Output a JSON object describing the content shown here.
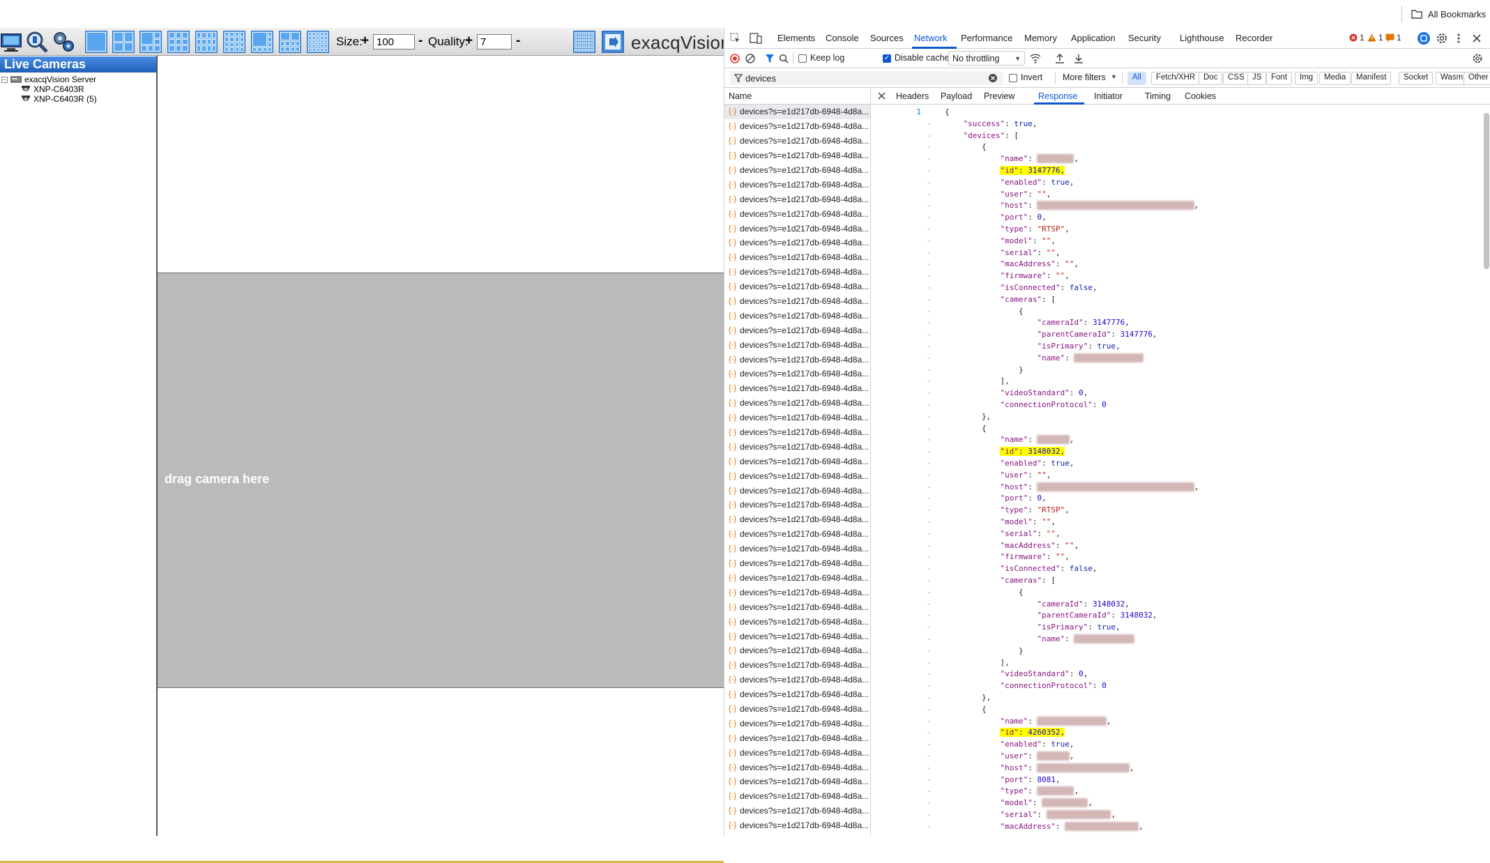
{
  "browser": {
    "bookmarks_label": "All Bookmarks"
  },
  "app": {
    "size_label": "Size:",
    "size_value": "100",
    "quality_label": "Quality:",
    "quality_value": "7",
    "plus": "+",
    "minus": "-",
    "brand": "exacqVision",
    "panel_title": "Live Cameras",
    "tree": {
      "server": "exacqVision Server",
      "cameras": [
        "XNP-C6403R",
        "XNP-C6403R (5)"
      ]
    },
    "drop_text": "drag camera here"
  },
  "devtools": {
    "tabs": [
      "Elements",
      "Console",
      "Sources",
      "Network",
      "Performance",
      "Memory",
      "Application",
      "Security",
      "Lighthouse",
      "Recorder"
    ],
    "active_tab": "Network",
    "badges": {
      "errors": "1",
      "warnings": "1",
      "issues": "1"
    },
    "toolbar": {
      "keep_log": "Keep log",
      "disable_cache": "Disable cache",
      "throttling": "No throttling"
    },
    "filter": {
      "value": "devices",
      "invert": "Invert",
      "more_filters": "More filters",
      "types": [
        "All",
        "Fetch/XHR",
        "Doc",
        "CSS",
        "JS",
        "Font",
        "Img",
        "Media",
        "Manifest",
        "Socket",
        "Wasm",
        "Other"
      ]
    },
    "name_header": "Name",
    "request_name": "devices?s=e1d217db-6948-4d8a...",
    "request_count": 50,
    "detail_tabs": [
      "Headers",
      "Payload",
      "Preview",
      "Response",
      "Initiator",
      "Timing",
      "Cookies"
    ],
    "active_detail_tab": "Response",
    "response_lines": [
      {
        "ln": "1",
        "t": "{"
      },
      {
        "t": "    \"success\": true,"
      },
      {
        "t": "    \"devices\": ["
      },
      {
        "t": "        {"
      },
      {
        "t": "            \"name\": \"██████\","
      },
      {
        "t": "            \"id\": 3147776,",
        "hl": true
      },
      {
        "t": "            \"enabled\": true,"
      },
      {
        "t": "            \"user\": \"\","
      },
      {
        "t": "            \"host\": \"████████████████████████████████\","
      },
      {
        "t": "            \"port\": 0,"
      },
      {
        "t": "            \"type\": \"RTSP\","
      },
      {
        "t": "            \"model\": \"\","
      },
      {
        "t": "            \"serial\": \"\","
      },
      {
        "t": "            \"macAddress\": \"\","
      },
      {
        "t": "            \"firmware\": \"\","
      },
      {
        "t": "            \"isConnected\": false,"
      },
      {
        "t": "            \"cameras\": ["
      },
      {
        "t": "                {"
      },
      {
        "t": "                    \"cameraId\": 3147776,"
      },
      {
        "t": "                    \"parentCameraId\": 3147776,"
      },
      {
        "t": "                    \"isPrimary\": true,"
      },
      {
        "t": "                    \"name\": \"█████████████\""
      },
      {
        "t": "                }"
      },
      {
        "t": "            ],"
      },
      {
        "t": "            \"videoStandard\": 0,"
      },
      {
        "t": "            \"connectionProtocol\": 0"
      },
      {
        "t": "        },"
      },
      {
        "t": "        {"
      },
      {
        "t": "            \"name\": \"█████\","
      },
      {
        "t": "            \"id\": 3148032,",
        "hl": true
      },
      {
        "t": "            \"enabled\": true,"
      },
      {
        "t": "            \"user\": \"\","
      },
      {
        "t": "            \"host\": \"████████████████████████████████\","
      },
      {
        "t": "            \"port\": 0,"
      },
      {
        "t": "            \"type\": \"RTSP\","
      },
      {
        "t": "            \"model\": \"\","
      },
      {
        "t": "            \"serial\": \"\","
      },
      {
        "t": "            \"macAddress\": \"\","
      },
      {
        "t": "            \"firmware\": \"\","
      },
      {
        "t": "            \"isConnected\": false,"
      },
      {
        "t": "            \"cameras\": ["
      },
      {
        "t": "                {"
      },
      {
        "t": "                    \"cameraId\": 3148032,"
      },
      {
        "t": "                    \"parentCameraId\": 3148032,"
      },
      {
        "t": "                    \"isPrimary\": true,"
      },
      {
        "t": "                    \"name\": \"███████████\""
      },
      {
        "t": "                }"
      },
      {
        "t": "            ],"
      },
      {
        "t": "            \"videoStandard\": 0,"
      },
      {
        "t": "            \"connectionProtocol\": 0"
      },
      {
        "t": "        },"
      },
      {
        "t": "        {"
      },
      {
        "t": "            \"name\": \"█████████████\","
      },
      {
        "t": "            \"id\": 4260352,",
        "hl": true
      },
      {
        "t": "            \"enabled\": true,"
      },
      {
        "t": "            \"user\": \"█████\","
      },
      {
        "t": "            \"host\": \"██████████████████\","
      },
      {
        "t": "            \"port\": 8081,"
      },
      {
        "t": "            \"type\": \"██████\","
      },
      {
        "t": "            \"model\": \"████████\","
      },
      {
        "t": "            \"serial\": \"████████████\","
      },
      {
        "t": "            \"macAddress\": \"██████████████\","
      }
    ]
  }
}
